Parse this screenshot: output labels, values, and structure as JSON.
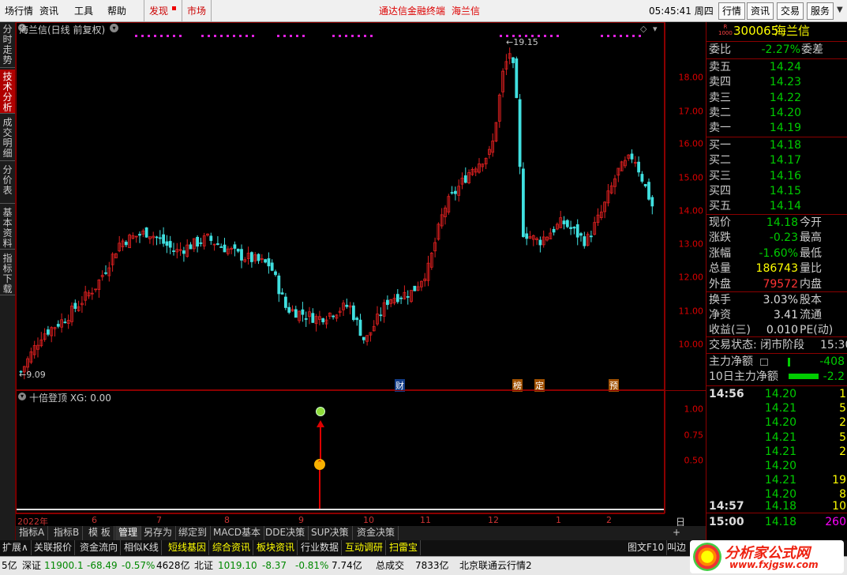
{
  "topbar": {
    "menu": [
      "场行情",
      "资讯",
      "工具",
      "帮助"
    ],
    "discover": "发现",
    "market": "市场",
    "center_title": "通达信金融终端",
    "stock_title": "海兰信",
    "clock": "05:45:41 周四",
    "buttons": [
      "行情",
      "资讯",
      "交易",
      "服务"
    ]
  },
  "leftnav": [
    "分时走势",
    "技术分析",
    "成交明细",
    "分价表",
    "基本资料",
    "指标下载"
  ],
  "main": {
    "title": "海兰信(日线 前复权)",
    "high_label": "19.15",
    "low_label": "9.09",
    "markers": [
      {
        "text": "财",
        "color": "#3366ff"
      },
      {
        "text": "榜",
        "color": "#ff8800"
      },
      {
        "text": "定",
        "color": "#ff8800"
      },
      {
        "text": "预",
        "color": "#ff8800"
      }
    ]
  },
  "yaxis_main": [
    "18.00",
    "17.00",
    "16.00",
    "15.00",
    "14.00",
    "13.00",
    "12.00",
    "11.00",
    "10.00"
  ],
  "yaxis_sub": [
    "1.00",
    "0.75",
    "0.50"
  ],
  "sub": {
    "title": "十倍登顶 XG: 0.00"
  },
  "xaxis": [
    "2022年",
    "6",
    "7",
    "8",
    "9",
    "10",
    "11",
    "12",
    "1",
    "2"
  ],
  "period": "日线",
  "tabs1": [
    "指标A",
    "指标B",
    "模 板",
    "管理",
    "另存为",
    "绑定到",
    "MACD基本",
    "DDE决策",
    "SUP决策",
    "资金决策"
  ],
  "tabs1_plus": "+",
  "tabs2": [
    "扩展∧",
    "关联报价",
    "资金流向",
    "相似K线",
    "短线基因",
    "综合资讯",
    "板块资讯",
    "行业数据",
    "互动调研",
    "扫雷宝"
  ],
  "tabs2_right": "图文F10",
  "tabs2_right2": "叫边",
  "status": [
    {
      "t": "5亿",
      "c": "#000"
    },
    {
      "t": "深证",
      "c": "#000"
    },
    {
      "t": "11900.1",
      "c": "#0a0"
    },
    {
      "t": "-68.49",
      "c": "#0a0"
    },
    {
      "t": "-0.57%",
      "c": "#0a0"
    },
    {
      "t": "4628亿",
      "c": "#000"
    },
    {
      "t": "北证",
      "c": "#000"
    },
    {
      "t": "1019.10",
      "c": "#0a0"
    },
    {
      "t": "-8.37",
      "c": "#0a0"
    },
    {
      "t": "-0.81%",
      "c": "#0a0"
    },
    {
      "t": "7.74亿",
      "c": "#000"
    },
    {
      "t": "总成交",
      "c": "#000"
    },
    {
      "t": "7833亿",
      "c": "#000"
    },
    {
      "t": "北京联通云行情2",
      "c": "#000"
    }
  ],
  "right": {
    "code": "300065",
    "name": "海兰信",
    "badge": "R\n1000",
    "webi_label": "委比",
    "webi_val": "-2.27%",
    "weicha": "委差",
    "sells": [
      {
        "l": "卖五",
        "p": "14.24"
      },
      {
        "l": "卖四",
        "p": "14.23"
      },
      {
        "l": "卖三",
        "p": "14.22"
      },
      {
        "l": "卖二",
        "p": "14.20"
      },
      {
        "l": "卖一",
        "p": "14.19"
      }
    ],
    "buys": [
      {
        "l": "买一",
        "p": "14.18"
      },
      {
        "l": "买二",
        "p": "14.17"
      },
      {
        "l": "买三",
        "p": "14.16"
      },
      {
        "l": "买四",
        "p": "14.15"
      },
      {
        "l": "买五",
        "p": "14.14"
      }
    ],
    "quote": [
      {
        "l": "现价",
        "v": "14.18",
        "vc": "g",
        "r": "今开"
      },
      {
        "l": "涨跌",
        "v": "-0.23",
        "vc": "g",
        "r": "最高"
      },
      {
        "l": "涨幅",
        "v": "-1.60%",
        "vc": "g",
        "r": "最低"
      },
      {
        "l": "总量",
        "v": "186743",
        "vc": "y",
        "r": "量比"
      },
      {
        "l": "外盘",
        "v": "79572",
        "vc": "r",
        "r": "内盘"
      }
    ],
    "stats": [
      {
        "l": "换手",
        "v": "3.03%",
        "r": "股本"
      },
      {
        "l": "净资",
        "v": "3.41",
        "r": "流通"
      },
      {
        "l": "收益(三)",
        "v": "0.010",
        "r": "PE(动)"
      }
    ],
    "trade_status": "交易状态: 闭市阶段",
    "trade_time": "15:30",
    "main_net": "主力净额",
    "main_net_val": "-408",
    "net10": "10日主力净额",
    "net10_val": "-2.2",
    "ticks": [
      {
        "t": "14:56",
        "p": "14.20",
        "v": "1"
      },
      {
        "t": "",
        "p": "14.21",
        "v": "5"
      },
      {
        "t": "",
        "p": "14.20",
        "v": "2"
      },
      {
        "t": "",
        "p": "14.21",
        "v": "5"
      },
      {
        "t": "",
        "p": "14.21",
        "v": "2"
      },
      {
        "t": "",
        "p": "14.20",
        "v": ""
      },
      {
        "t": "",
        "p": "14.21",
        "v": "19"
      },
      {
        "t": "",
        "p": "14.20",
        "v": "8"
      },
      {
        "t": "14:57",
        "p": "14.18",
        "v": "10"
      },
      {
        "t": "15:00",
        "p": "14.18",
        "v": "260"
      }
    ]
  },
  "watermark": {
    "text": "分析家公式网",
    "url": "www.fxjgsw.com"
  }
}
